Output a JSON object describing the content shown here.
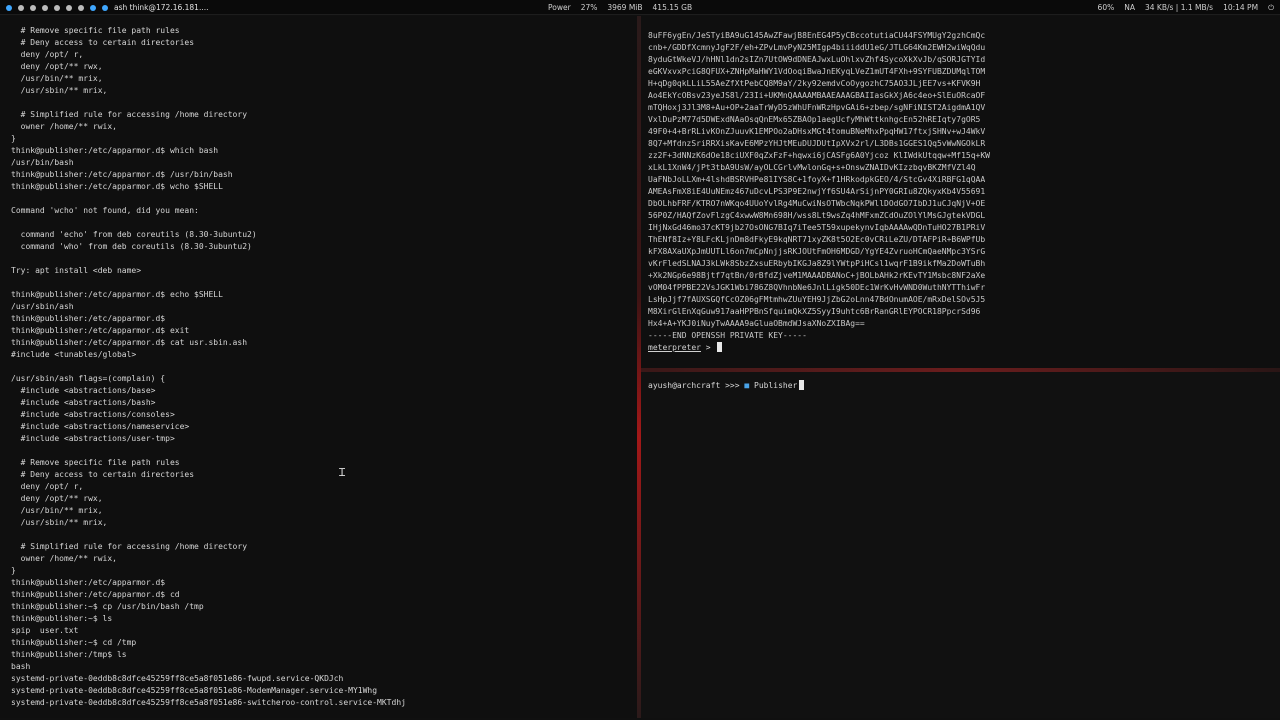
{
  "topbar": {
    "window_title": "ash think@172.16.181....",
    "power": "Power",
    "cpu": "27%",
    "ram": "3969 MiB",
    "disk": "415.15 GB",
    "volume": "60%",
    "wifi": "NA",
    "net": "34 KB/s | 1.1 MB/s",
    "clock": "10:14 PM"
  },
  "left_terminal": {
    "lines": [
      "  # Remove specific file path rules",
      "  # Deny access to certain directories",
      "  deny /opt/ r,",
      "  deny /opt/** rwx,",
      "  /usr/bin/** mrix,",
      "  /usr/sbin/** mrix,",
      "",
      "  # Simplified rule for accessing /home directory",
      "  owner /home/** rwix,",
      "}",
      "think@publisher:/etc/apparmor.d$ which bash",
      "/usr/bin/bash",
      "think@publisher:/etc/apparmor.d$ /usr/bin/bash",
      "think@publisher:/etc/apparmor.d$ wcho $SHELL",
      "",
      "Command 'wcho' not found, did you mean:",
      "",
      "  command 'echo' from deb coreutils (8.30-3ubuntu2)",
      "  command 'who' from deb coreutils (8.30-3ubuntu2)",
      "",
      "Try: apt install <deb name>",
      "",
      "think@publisher:/etc/apparmor.d$ echo $SHELL",
      "/usr/sbin/ash",
      "think@publisher:/etc/apparmor.d$",
      "think@publisher:/etc/apparmor.d$ exit",
      "think@publisher:/etc/apparmor.d$ cat usr.sbin.ash",
      "#include <tunables/global>",
      "",
      "/usr/sbin/ash flags=(complain) {",
      "  #include <abstractions/base>",
      "  #include <abstractions/bash>",
      "  #include <abstractions/consoles>",
      "  #include <abstractions/nameservice>",
      "  #include <abstractions/user-tmp>",
      "",
      "  # Remove specific file path rules",
      "  # Deny access to certain directories",
      "  deny /opt/ r,",
      "  deny /opt/** rwx,",
      "  /usr/bin/** mrix,",
      "  /usr/sbin/** mrix,",
      "",
      "  # Simplified rule for accessing /home directory",
      "  owner /home/** rwix,",
      "}",
      "think@publisher:/etc/apparmor.d$",
      "think@publisher:/etc/apparmor.d$ cd",
      "think@publisher:~$ cp /usr/bin/bash /tmp",
      "think@publisher:~$ ls",
      "spip  user.txt",
      "think@publisher:~$ cd /tmp",
      "think@publisher:/tmp$ ls",
      "bash",
      "systemd-private-0eddb8c8dfce45259ff8ce5a8f051e86-fwupd.service-QKDJch",
      "systemd-private-0eddb8c8dfce45259ff8ce5a8f051e86-ModemManager.service-MY1Whg",
      "systemd-private-0eddb8c8dfce45259ff8ce5a8f051e86-switcheroo-control.service-MKTdhj"
    ]
  },
  "right_top_terminal": {
    "lines": [
      "8uFF6ygEn/JeSTyiBA9uG145AwZFawjB8EnEG4P5yCBccotutiaCU44FSYMUgY2gzhCmQc",
      "cnb+/GDDfXcmnyJgF2F/eh+ZPvLmvPyN25MIgp4biiiddU1eG/JTLG64Km2EWH2wiWqQdu",
      "8yduGtWkeVJ/hHNl1dn2sIZn7UtOW9dDNEAJwxLuOhlxvZhf4SycoXkXvJb/qSORJGTYId",
      "eGKVxvxPciG8QFUX+ZNHpMaHWY1VdOoqiBwaJnEKyqLVeZ1mUT4FXh+9SYFUBZDUMqlTOM",
      "H+qDg0qkLLiL55AeZfXtPebCQ8M9aY/2ky92emdvCoOygozhC75AO3JLjEE7vs+KFVK9H",
      "Ao4EkYcOBsv23yeJS8l/23Ii+UKMnQAAAAMBAAEAAAGBAIIasGkXjA6c4eo+SlEuORcaOF",
      "mTQHoxj3Jl3M8+Au+OP+2aaTrWyD5zWhUFnWRzHpvGAi6+zbep/sgNFiNIST2AigdmA1QV",
      "VxlDuPzM77d5DWExdNAaOsqQnEMx65ZBAOp1aegUcfyMhWttknhgcEn52hREIqty7gOR5",
      "49F0+4+BrRLivKOnZJuuvK1EMPOo2aDHsxMGt4tomuBNeMhxPpqHW17ftxjSHNv+wJ4WkV",
      "8Q7+MfdnzSriRRXisKavE6MPzYHJtMEuDUJDUtIpXVx2rl/L3DBs1GGES1Qq5vWwNGOkLR",
      "zz2F+3dNNzK6dOe18ciUXF0qZxFzF+hqwxi6jCASFg6A0Yjcoz KlIWdkUtqqw+Mf15q+KW",
      "xLkL1XnW4/jPt3tbA9UsW/ayOLCGrlvMwlonGq+s+OnswZNAIDvKIzzbqvBKZMfVZl4Q",
      "UaFNbJoLLXm+4lshdBSRVHPe81IYS8C+1foyX+f1HRkodpkGEO/4/StcGv4XiRBFG1qQAA",
      "AMEAsFmX8iE4UuNEmz467uDcvLPS3P9E2nwjYf6SU4ArSijnPY0GRIu8ZQkyxKb4V55691",
      "DbOLhbFRF/KTRO7nWKqo4UUoYvlRg4MuCwiNsOTWbcNqkPWllDOdGO7IbDJ1uCJqNjV+OE",
      "56P0Z/HAQfZovFlzgC4xwwW8Mn698H/wss8Lt9wsZq4hMFxmZCdOuZOlYlMsGJgtekVDGL",
      "IHjNxGd46mo37cKT9jb27OsONG7BIq7iTee5T59xupekynvIqbAAAAwQDnTuHO27B1PRiV",
      "ThENf8Iz+Y8LFcKLjnDm8dFkyE9kqNRT71xyZK8t5O2Ec0vCRiLeZU/DTAFPiR+B6WPfUb",
      "kFX8AXaUXpJmUUTLl6on7mCpNnjjsRKJOUtFmOH6MDGD/YgYE4ZvruoHCmQaeNMpc3YSrG",
      "vKrFledSLNAJ3kLWk8SbzZxsuERbybIKGJa8Z9lYWtpPiHCsl1wqrF1B9ikfMa2DoWTuBh",
      "+Xk2NGp6e98Bjtf7qtBn/0rBfdZjveM1MAAADBANoC+jBOLbAHk2rKEvTY1Msbc8NF2aXe",
      "vOM04fPPBE22VsJGK1Wbi786Z8QVhnbNe6JnlLigk50DEc1WrKvHvWND0WuthNYTThiwFr",
      "LsHpJjf7fAUXSGQfCcOZ06gFMtmhwZUuYEH9JjZbG2oLnn47BdOnumAOE/mRxDelSOv5J5",
      "M8XirGlEnXqGuw917aaHPPBnSfquimQkXZ5SyyI9uhtc6BrRanGRlEYPOCR18PpcrSd96",
      "Hx4+A+YKJ0iNuyTwAAAA9aGluaOBmdWJsaXNoZXIBAg==",
      "-----END OPENSSH PRIVATE KEY-----"
    ],
    "prompt": "meterpreter",
    "prompt_suffix": " > "
  },
  "right_bottom_terminal": {
    "user": "ayush",
    "host": "@archcraft",
    "sep": " >>> ",
    "folder_icon": "folder-icon",
    "dir": "Publisher"
  },
  "colors": {
    "folder": "#49a3e8",
    "divider": "#a31818"
  }
}
